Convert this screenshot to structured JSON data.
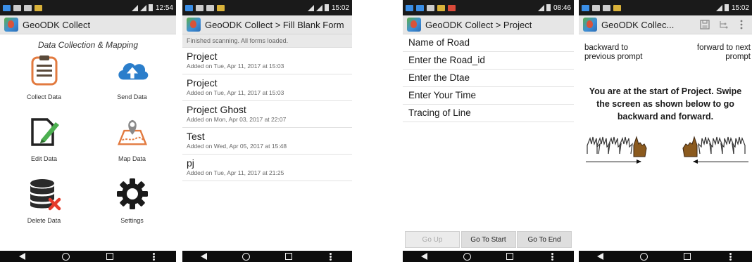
{
  "status_times": [
    "12:54",
    "15:02",
    "08:46",
    "15:02"
  ],
  "main_menu": {
    "title": "GeoODK Collect",
    "subtitle": "Data Collection & Mapping",
    "items": [
      {
        "label": "Collect Data",
        "icon": "clipboard-icon"
      },
      {
        "label": "Send Data",
        "icon": "cloud-upload-icon"
      },
      {
        "label": "Edit Data",
        "icon": "edit-document-icon"
      },
      {
        "label": "Map Data",
        "icon": "map-pin-icon"
      },
      {
        "label": "Delete Data",
        "icon": "database-delete-icon"
      },
      {
        "label": "Settings",
        "icon": "gear-icon"
      }
    ]
  },
  "fill_form": {
    "title": "GeoODK Collect > Fill Blank Form",
    "status": "Finished scanning. All forms loaded.",
    "forms": [
      {
        "name": "Project",
        "added": "Added on Tue, Apr 11, 2017 at 15:03"
      },
      {
        "name": "Project",
        "added": "Added on Tue, Apr 11, 2017 at 15:03"
      },
      {
        "name": "Project Ghost",
        "added": "Added on Mon, Apr 03, 2017 at 22:07"
      },
      {
        "name": "Test",
        "added": "Added on Wed, Apr 05, 2017 at 15:48"
      },
      {
        "name": "pj",
        "added": "Added on Tue, Apr 11, 2017 at 21:25"
      }
    ]
  },
  "hierarchy": {
    "title": "GeoODK Collect > Project",
    "questions": [
      "Name of Road",
      "Enter the Road_id",
      "Enter the Dtae",
      "Enter Your Time",
      "Tracing of Line"
    ],
    "buttons": {
      "up": "Go Up",
      "start": "Go To Start",
      "end": "Go To End"
    }
  },
  "form_entry": {
    "title": "GeoODK Collec...",
    "intro": "You are at the start of Project. Swipe the screen as shown below to go backward and forward.",
    "backward": "backward to previous prompt",
    "forward": "forward to next prompt"
  },
  "colors": {
    "accent_blue": "#2b7ecb",
    "delete_red": "#e53b2c",
    "map_orange": "#e27a3f",
    "edit_green": "#4caf50",
    "hand_brown": "#8b5a1e"
  }
}
